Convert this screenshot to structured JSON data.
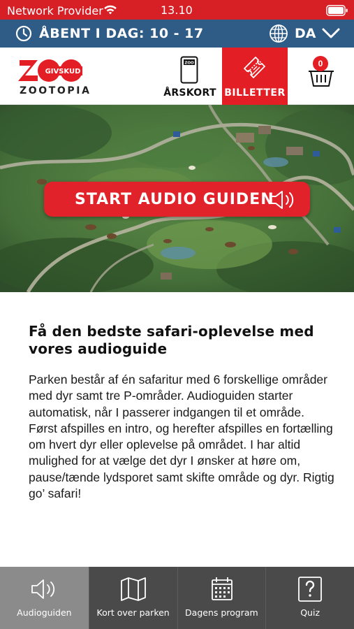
{
  "status_bar": {
    "carrier": "Network Provider",
    "time": "13.10",
    "wifi_icon": "wifi-icon",
    "battery_icon": "battery-icon"
  },
  "open_bar": {
    "hours_text": "ÅBENT I DAG: 10 - 17",
    "language": "DA",
    "clock_icon": "clock-icon",
    "globe_icon": "globe-icon",
    "chevron_icon": "chevron-down-icon"
  },
  "header": {
    "logo": {
      "brand": "ZOO",
      "badge": "GIVSKUD",
      "subtitle": "ZOOTOPIA"
    },
    "arskort_label": "ÅRSKORT",
    "arskort_card_text": "ZOO",
    "billetter_label": "BILLETTER",
    "cart_count": "0"
  },
  "hero": {
    "button_label": "START AUDIO GUIDEN"
  },
  "content": {
    "title": "Få den bedste safari-oplevelse med vores audioguide",
    "body": "Parken består af én safaritur med 6 forskellige områder med dyr samt tre P-områder. Audioguiden starter automatisk, når I passerer indgangen til et område. Først afspilles en intro, og herefter afspilles en fortælling om hvert dyr eller oplevelse på området. I har altid mulighed for at vælge det dyr I ønsker at høre om, pause/tænde lydsporet samt skifte område og dyr. Rigtig go’ safari!"
  },
  "bottom_nav": {
    "items": [
      {
        "label": "Audioguiden",
        "icon": "speaker-icon",
        "active": true
      },
      {
        "label": "Kort over parken",
        "icon": "map-icon",
        "active": false
      },
      {
        "label": "Dagens program",
        "icon": "calendar-icon",
        "active": false
      },
      {
        "label": "Quiz",
        "icon": "question-icon",
        "active": false
      }
    ]
  },
  "colors": {
    "brand_red": "#e31e24",
    "top_bar_blue": "#2f5b87",
    "nav_dark": "#4a4a4a",
    "nav_active": "#8b8b8b"
  }
}
